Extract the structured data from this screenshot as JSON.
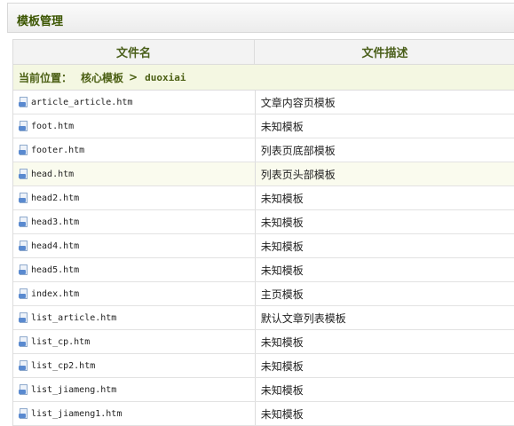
{
  "panel": {
    "title": "模板管理"
  },
  "columns": {
    "name": "文件名",
    "desc": "文件描述"
  },
  "breadcrumb": {
    "label": "当前位置：",
    "node": "核心模板",
    "arrow": ">",
    "current": "duoxiai"
  },
  "files": [
    {
      "name": "article_article.htm",
      "desc": "文章内容页模板"
    },
    {
      "name": "foot.htm",
      "desc": "未知模板"
    },
    {
      "name": "footer.htm",
      "desc": "列表页底部模板"
    },
    {
      "name": "head.htm",
      "desc": "列表页头部模板"
    },
    {
      "name": "head2.htm",
      "desc": "未知模板"
    },
    {
      "name": "head3.htm",
      "desc": "未知模板"
    },
    {
      "name": "head4.htm",
      "desc": "未知模板"
    },
    {
      "name": "head5.htm",
      "desc": "未知模板"
    },
    {
      "name": "index.htm",
      "desc": "主页模板"
    },
    {
      "name": "list_article.htm",
      "desc": "默认文章列表模板"
    },
    {
      "name": "list_cp.htm",
      "desc": "未知模板"
    },
    {
      "name": "list_cp2.htm",
      "desc": "未知模板"
    },
    {
      "name": "list_jiameng.htm",
      "desc": "未知模板"
    },
    {
      "name": "list_jiameng1.htm",
      "desc": "未知模板"
    }
  ]
}
